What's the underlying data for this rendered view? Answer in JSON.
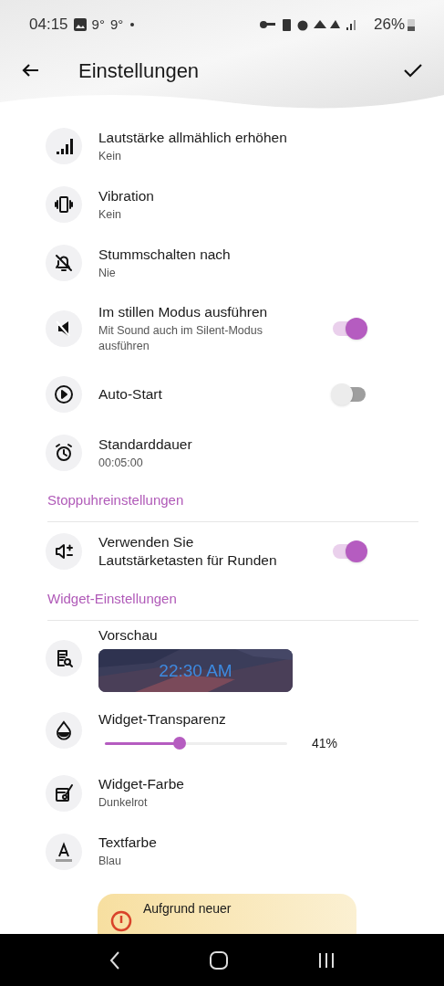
{
  "status_bar": {
    "time": "04:15",
    "temps": [
      "9°",
      "9°"
    ],
    "battery": "26%"
  },
  "header": {
    "title": "Einstellungen"
  },
  "items": [
    {
      "kind": "setting",
      "title": "Lautstärke allmählich erhöhen",
      "subtitle": "Kein"
    },
    {
      "kind": "setting",
      "title": "Vibration",
      "subtitle": "Kein"
    },
    {
      "kind": "setting",
      "title": "Stummschalten nach",
      "subtitle": "Nie"
    },
    {
      "kind": "toggle",
      "title": "Im stillen Modus ausführen",
      "subtitle": "Mit Sound auch im Silent-Modus ausführen",
      "on": true
    },
    {
      "kind": "toggle",
      "title": "Auto-Start",
      "on": false
    },
    {
      "kind": "setting",
      "title": "Standarddauer",
      "subtitle": "00:05:00"
    },
    {
      "kind": "section",
      "title": "Stoppuhreinstellungen"
    },
    {
      "kind": "toggle",
      "title": "Verwenden Sie Lautstärketasten für Runden",
      "on": true
    },
    {
      "kind": "section",
      "title": "Widget-Einstellungen"
    },
    {
      "kind": "preview",
      "title": "Vorschau",
      "time": "22:30 AM"
    },
    {
      "kind": "slider",
      "title": "Widget-Transparenz",
      "level": 0.41,
      "reading": "41%"
    },
    {
      "kind": "setting",
      "title": "Widget-Farbe",
      "subtitle": "Dunkelrot"
    },
    {
      "kind": "setting",
      "title": "Textfarbe",
      "subtitle": "Blau"
    },
    {
      "kind": "banner",
      "text": "Aufgrund neuer"
    }
  ]
}
